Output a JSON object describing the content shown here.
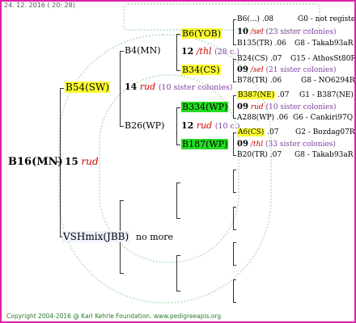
{
  "header": {
    "date": "24. 12. 2016 ( 20: 28)"
  },
  "footer": {
    "copyright": "Copyright 2004-2016 @ Karl Kehrle Foundation.   www.pedigreeapis.org"
  },
  "subject": {
    "name": "B16(MN)",
    "year": "15",
    "breeder": "rud"
  },
  "mother": {
    "name": "B54(SW)",
    "year": "14",
    "breeder": "rud",
    "sisters": "(10 sister colonies)"
  },
  "father": {
    "name": "VSHmix(JBB)",
    "note": "no more"
  },
  "mm": {
    "name": "B4(MN)"
  },
  "mf": {
    "name": "B26(WP)",
    "year": "12",
    "breeder": "rud",
    "sisters": "(10 c.)"
  },
  "mmm": {
    "name": "B6(YOB)",
    "year": "12",
    "breeder": "/thl",
    "sisters": "(28 c.)"
  },
  "mmf": {
    "name": "B34(CS)"
  },
  "mfm": {
    "name": "B334(WP)"
  },
  "mff": {
    "name": "B187(WP)"
  },
  "gen4": [
    {
      "a1": "B6(...)",
      "a1v": ".08",
      "a2": "G0 - not registe",
      "b1": "10",
      "b2": "/sel",
      "b3": "(23 sister colonies)",
      "c1": "B135(TR)",
      "c1v": ".06",
      "c2": "G8 - Takab93aR"
    },
    {
      "a1": "B24(CS)",
      "a1v": ".07",
      "a2": "G15 - AthosSt80R",
      "b1": "09",
      "b2": "/sel",
      "b3": "(21 sister colonies)",
      "c1": "B78(TR)",
      "c1v": ".06",
      "c2": "G8 - NO6294R"
    },
    {
      "a1": "B387(NE)",
      "a1v": ".07",
      "a2": "G1 - B387(NE)",
      "b1": "09",
      "b2": "rud",
      "b3": "(10 sister colonies)",
      "c1": "A288(WP)",
      "c1v": ".06",
      "c2": "G6 - Cankiri97Q"
    },
    {
      "a1": "A6(CS)",
      "a1v": ".07",
      "a2": "G2 - Bozdag07R",
      "b1": "09",
      "b2": "/thl",
      "b3": "(33 sister colonies)",
      "c1": "B20(TR)",
      "c1v": ".07",
      "c2": "G8 - Takab93aR"
    }
  ],
  "colors": {
    "border": "#e020a8",
    "yellow": "#ffff33",
    "green": "#22dd22",
    "breeder": "#d00000",
    "sisters": "#8040a0",
    "codes": "#2020b0",
    "watermark": "#c9e6c9"
  }
}
